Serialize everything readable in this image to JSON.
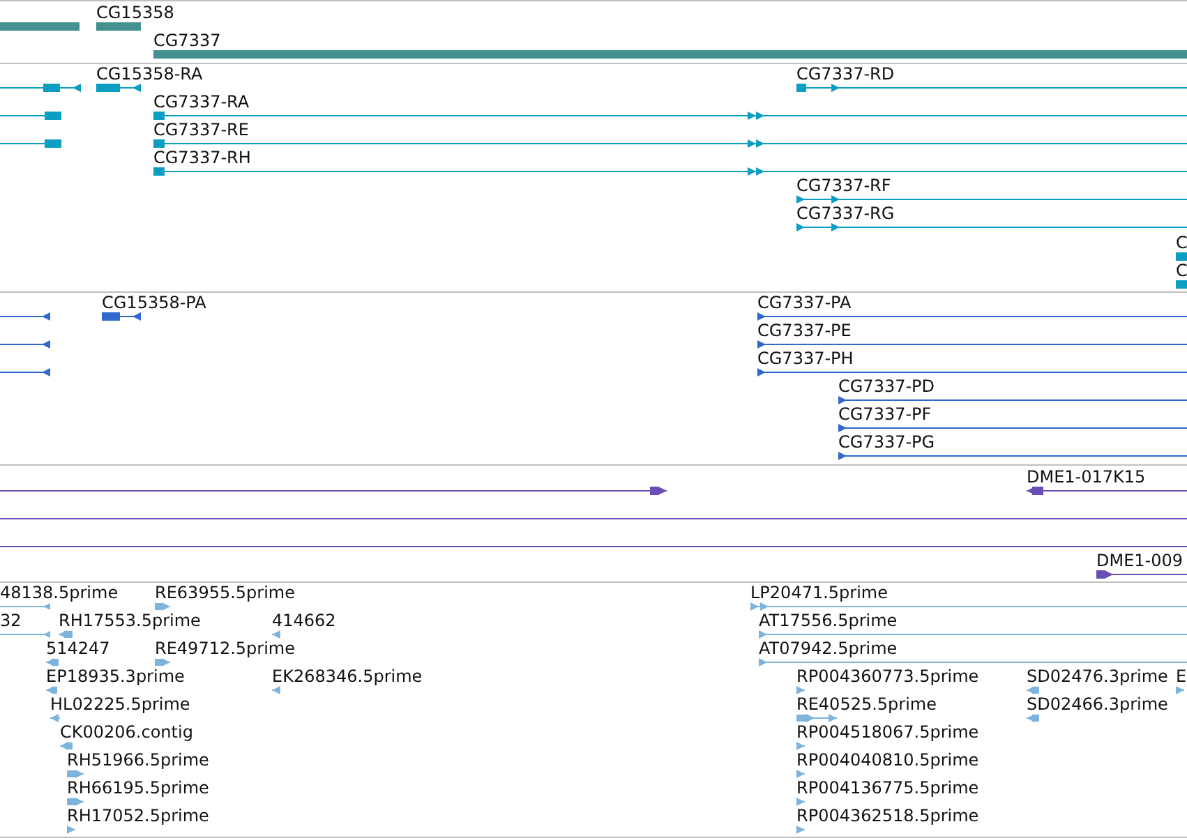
{
  "tracks": [
    {
      "kind": "gene",
      "color": "#43908f",
      "features": [
        {
          "kind": "plain"
        },
        {
          "label": "CG15358",
          "kind": "reverse"
        },
        {
          "label": "CG7337",
          "kind": "plain"
        }
      ]
    },
    {
      "kind": "transcript",
      "color": "#0a9ec3",
      "features": [
        {
          "kind": "reverse"
        },
        {
          "label": "CG15358-RA",
          "kind": "reverse"
        },
        {
          "label": "CG7337-RD",
          "kind": "forward"
        },
        {
          "kind": "reverse"
        },
        {
          "label": "CG7337-RA",
          "kind": "forward"
        },
        {
          "kind": "reverse"
        },
        {
          "label": "CG7337-RE",
          "kind": "forward"
        },
        {
          "label": "CG7337-RH",
          "kind": "forward"
        },
        {
          "label": "CG7337-RF",
          "kind": "forward"
        },
        {
          "label": "CG7337-RG",
          "kind": "forward"
        },
        {
          "label": "C",
          "kind": "plain"
        },
        {
          "label": "C",
          "kind": "plain"
        }
      ]
    },
    {
      "kind": "protein",
      "color": "#3068d0",
      "features": [
        {
          "kind": "reverse"
        },
        {
          "label": "CG15358-PA",
          "kind": "reverse"
        },
        {
          "label": "CG7337-PA",
          "kind": "forward"
        },
        {
          "kind": "reverse"
        },
        {
          "label": "CG7337-PE",
          "kind": "forward"
        },
        {
          "kind": "reverse"
        },
        {
          "label": "CG7337-PH",
          "kind": "forward"
        },
        {
          "label": "CG7337-PD",
          "kind": "forward"
        },
        {
          "label": "CG7337-PF",
          "kind": "forward"
        },
        {
          "label": "CG7337-PG",
          "kind": "forward"
        }
      ]
    },
    {
      "kind": "clone",
      "color": "#6a4db5",
      "features": [
        {
          "kind": "forward"
        },
        {
          "label": "DME1-017K15",
          "kind": "reverse"
        },
        {
          "kind": "plain"
        },
        {
          "kind": "plain"
        },
        {
          "label": "DME1-009",
          "kind": "forward"
        }
      ]
    },
    {
      "kind": "est",
      "color": "#7db4dd",
      "features": [
        {
          "label": "48138.5prime",
          "kind": "reverse"
        },
        {
          "label": "RE63955.5prime",
          "kind": "forward"
        },
        {
          "label": "LP20471.5prime",
          "kind": "forward"
        },
        {
          "label": "32",
          "kind": "reverse"
        },
        {
          "label": "RH17553.5prime",
          "kind": "reverse"
        },
        {
          "label": "414662",
          "kind": "reverse"
        },
        {
          "label": "AT17556.5prime",
          "kind": "forward"
        },
        {
          "label": "514247",
          "kind": "reverse"
        },
        {
          "label": "RE49712.5prime",
          "kind": "forward"
        },
        {
          "label": "AT07942.5prime",
          "kind": "forward"
        },
        {
          "label": "EP18935.3prime",
          "kind": "reverse"
        },
        {
          "label": "EK268346.5prime",
          "kind": "reverse"
        },
        {
          "label": "RP004360773.5prime",
          "kind": "forward"
        },
        {
          "label": "SD02476.3prime",
          "kind": "reverse"
        },
        {
          "label": "E",
          "kind": "forward"
        },
        {
          "label": "HL02225.5prime",
          "kind": "reverse"
        },
        {
          "label": "RE40525.5prime",
          "kind": "forward"
        },
        {
          "label": "SD02466.3prime",
          "kind": "reverse"
        },
        {
          "label": "CK00206.contig",
          "kind": "reverse"
        },
        {
          "label": "RP004518067.5prime",
          "kind": "forward"
        },
        {
          "label": "RH51966.5prime",
          "kind": "forward"
        },
        {
          "label": "RP004040810.5prime",
          "kind": "forward"
        },
        {
          "label": "RH66195.5prime",
          "kind": "forward"
        },
        {
          "label": "RP004136775.5prime",
          "kind": "forward"
        },
        {
          "label": "RH17052.5prime",
          "kind": "forward"
        },
        {
          "label": "RP004362518.5prime",
          "kind": "forward"
        }
      ]
    }
  ]
}
